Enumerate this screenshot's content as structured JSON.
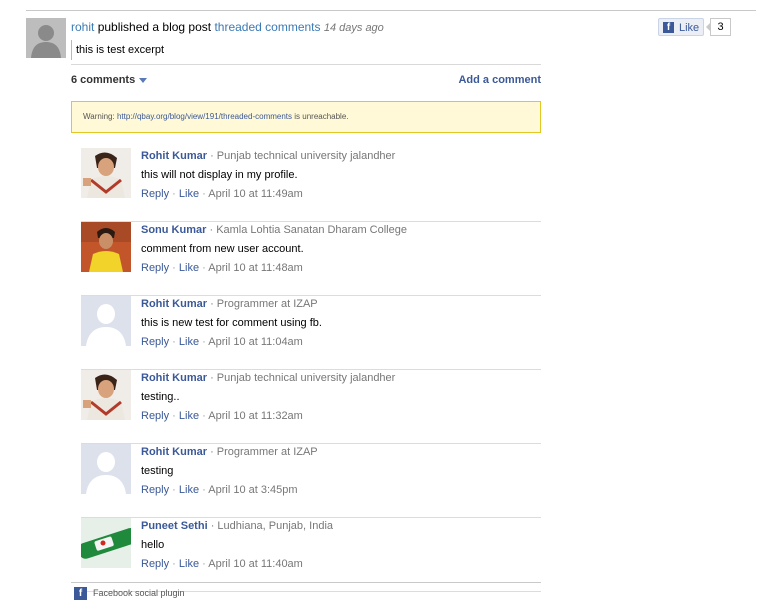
{
  "post": {
    "user": "rohit",
    "action": "published a blog post",
    "title": "threaded comments",
    "time": "14 days ago",
    "excerpt": "this is test excerpt"
  },
  "like": {
    "label": "Like",
    "count": "3"
  },
  "comments_header": {
    "count_label": "6 comments",
    "add_label": "Add a comment"
  },
  "warning": {
    "prefix": "Warning:",
    "url": "http://qbay.org/blog/view/191/threaded-comments",
    "suffix": "is unreachable."
  },
  "comments": [
    {
      "name": "Rohit Kumar",
      "affiliation": "· Punjab technical university jalandher",
      "text": "this will not display in my profile.",
      "reply": "Reply",
      "like": "Like",
      "time": "April 10 at 11:49am",
      "avatar": "photo-avatar"
    },
    {
      "name": "Sonu Kumar",
      "affiliation": "· Kamla Lohtia Sanatan Dharam College",
      "text": "comment from new user account.",
      "reply": "Reply",
      "like": "Like",
      "time": "April 10 at 11:48am",
      "avatar": "photo-avatar"
    },
    {
      "name": "Rohit Kumar",
      "affiliation": "· Programmer at IZAP",
      "text": "this is new test for comment using fb.",
      "reply": "Reply",
      "like": "Like",
      "time": "April 10 at 11:04am",
      "avatar": "default-avatar"
    },
    {
      "name": "Rohit Kumar",
      "affiliation": "· Punjab technical university jalandher",
      "text": "testing..",
      "reply": "Reply",
      "like": "Like",
      "time": "April 10 at 11:32am",
      "avatar": "photo-avatar"
    },
    {
      "name": "Rohit Kumar",
      "affiliation": "· Programmer at IZAP",
      "text": "testing",
      "reply": "Reply",
      "like": "Like",
      "time": "April 10 at 3:45pm",
      "avatar": "default-avatar"
    },
    {
      "name": "Puneet Sethi",
      "affiliation": "· Ludhiana, Punjab, India",
      "text": "hello",
      "reply": "Reply",
      "like": "Like",
      "time": "April 10 at 11:40am",
      "avatar": "photo-avatar"
    }
  ],
  "plugin": {
    "label": "Facebook social plugin"
  },
  "colors": {
    "link": "#3b5998",
    "post_link": "#3b7ab6",
    "warning_bg": "#fff9d7",
    "warning_border": "#e2c822"
  }
}
